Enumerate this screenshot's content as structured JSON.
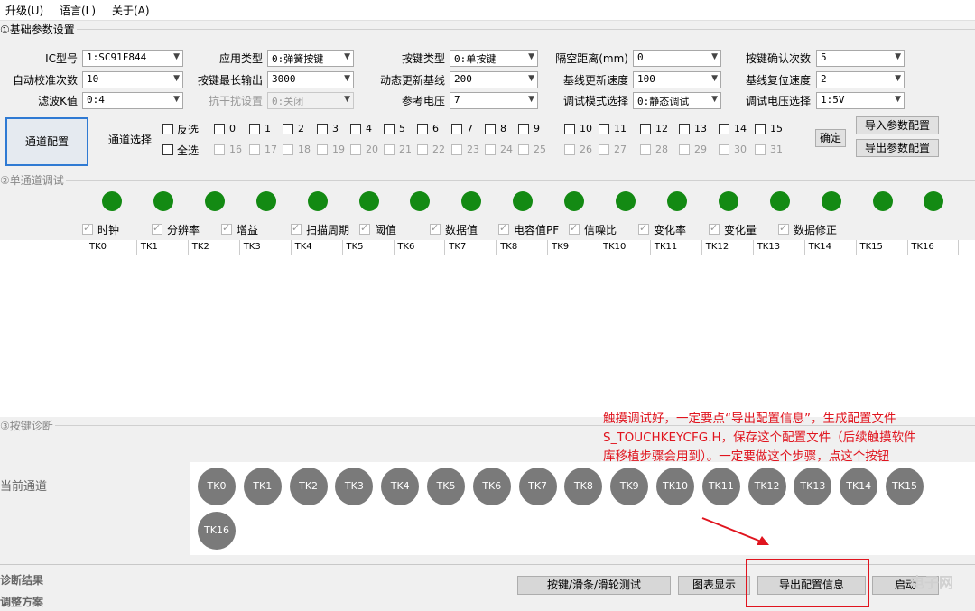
{
  "menu": [
    "升级(U)",
    "语言(L)",
    "关于(A)"
  ],
  "section1": {
    "title": "①基础参数设置"
  },
  "params": [
    {
      "label": "IC型号",
      "value": "1:SC91F844",
      "disabled": false
    },
    {
      "label": "应用类型",
      "value": "0:弹簧按键",
      "disabled": false
    },
    {
      "label": "按键类型",
      "value": "0:单按键",
      "disabled": false
    },
    {
      "label": "隔空距离(mm)",
      "value": "0",
      "disabled": false
    },
    {
      "label": "按键确认次数",
      "value": "5",
      "disabled": false
    },
    {
      "label": "自动校准次数",
      "value": "10",
      "disabled": false
    },
    {
      "label": "按键最长输出",
      "value": "3000",
      "disabled": false
    },
    {
      "label": "动态更新基线",
      "value": "200",
      "disabled": false
    },
    {
      "label": "基线更新速度",
      "value": "100",
      "disabled": false
    },
    {
      "label": "基线复位速度",
      "value": "2",
      "disabled": false
    },
    {
      "label": "滤波K值",
      "value": "0:4",
      "disabled": false
    },
    {
      "label": "抗干扰设置",
      "value": "0:关闭",
      "disabled": true
    },
    {
      "label": "参考电压",
      "value": "7",
      "disabled": false
    },
    {
      "label": "调试模式选择",
      "value": "0:静态调试",
      "disabled": false
    },
    {
      "label": "调试电压选择",
      "value": "1:5V",
      "disabled": false
    }
  ],
  "channel_config_button": "通道配置",
  "channel_select_label": "通道选择",
  "invert_label": "反选",
  "select_all_label": "全选",
  "channels_row1": [
    "0",
    "1",
    "2",
    "3",
    "4",
    "5",
    "6",
    "7",
    "8",
    "9",
    "10",
    "11",
    "12",
    "13",
    "14",
    "15"
  ],
  "channels_row2": [
    "16",
    "17",
    "18",
    "19",
    "20",
    "21",
    "22",
    "23",
    "24",
    "25",
    "26",
    "27",
    "28",
    "29",
    "30",
    "31"
  ],
  "confirm_button": "确定",
  "import_button": "导入参数配置",
  "export_params_button": "导出参数配置",
  "section2": {
    "title": "②单通道调试"
  },
  "status_dots": 17,
  "options": [
    "时钟",
    "分辨率",
    "增益",
    "扫描周期",
    "阈值",
    "数据值",
    "电容值PF",
    "信噪比",
    "变化率",
    "变化量",
    "数据修正"
  ],
  "table_headers": [
    "TK0",
    "TK1",
    "TK2",
    "TK3",
    "TK4",
    "TK5",
    "TK6",
    "TK7",
    "TK8",
    "TK9",
    "TK10",
    "TK11",
    "TK12",
    "TK13",
    "TK14",
    "TK15",
    "TK16"
  ],
  "section3": {
    "title": "③按键诊断"
  },
  "current_channel_label": "当前通道",
  "diag_keys": [
    "TK0",
    "TK1",
    "TK2",
    "TK3",
    "TK4",
    "TK5",
    "TK6",
    "TK7",
    "TK8",
    "TK9",
    "TK10",
    "TK11",
    "TK12",
    "TK13",
    "TK14",
    "TK15",
    "TK16"
  ],
  "diag_result_label": "诊断结果",
  "adjust_plan_label": "调整方案",
  "bottom_buttons": [
    "按键/滑条/滑轮测试",
    "图表显示",
    "导出配置信息",
    "启动"
  ],
  "annotation": {
    "line1": "触摸调试好，一定要点“导出配置信息”，生成配置文件",
    "line2": "S_TOUCHKEYCFG.H，保存这个配置文件（后续触摸软件",
    "line3": "库移植步骤会用到）。一定要做这个步骤，点这个按钮",
    "color": "#e0141e"
  },
  "watermark": "电子网"
}
